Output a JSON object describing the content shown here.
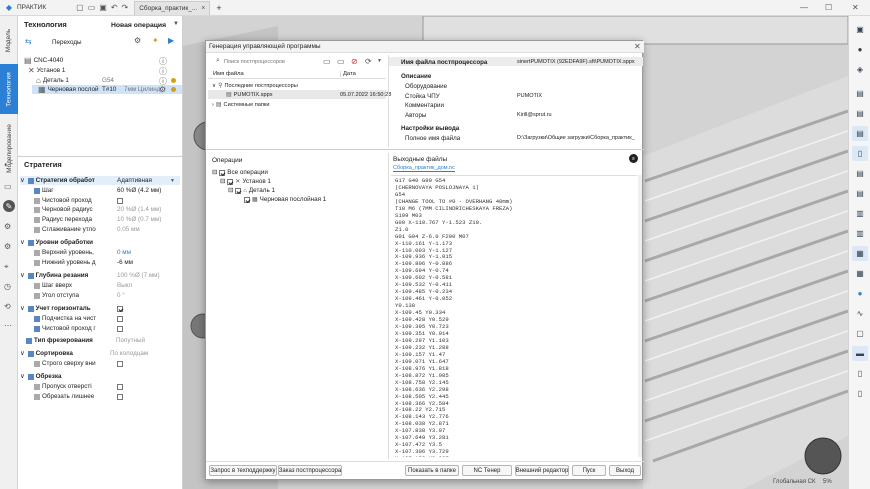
{
  "titlebar": {
    "app_name": "ПРАКТИК",
    "doc_tab": "Сборка_практик_...",
    "add_tab": "+"
  },
  "vtabs": [
    "Модель",
    "Технология",
    "Моделирование"
  ],
  "left": {
    "tech_title": "Технология",
    "new_op": "Новая операция",
    "transitions": "Переходы",
    "tree": {
      "machine": "CNC-4040",
      "setup": "Установ 1",
      "part": "Деталь 1",
      "part_g": "G54",
      "op": "Черновая послой",
      "op_tool": "T#10",
      "op_info": "7мм Цилинд"
    },
    "strategy_title": "Стратегия",
    "groups": [
      {
        "label": "Стратегия обработ",
        "value": "Адаптивная"
      },
      {
        "label": "Шаг",
        "value": "60 %Ø (4.2 мм)"
      },
      {
        "label": "Чистовой проход",
        "value": ""
      },
      {
        "label": "Черновой радиус",
        "value": "20 %Ø (1.4 мм)"
      },
      {
        "label": "Радиус перехода",
        "value": "10 %Ø (0.7 мм)"
      },
      {
        "label": "Сглаживание утло",
        "value": "0.05 мм"
      },
      {
        "label": "Уровни обработки",
        "value": ""
      },
      {
        "label": "Верхний уровень,",
        "value": "0 мм"
      },
      {
        "label": "Нижний уровень д",
        "value": "-6 мм"
      },
      {
        "label": "Глубина резания",
        "value": "100 %Ø (7 мм)"
      },
      {
        "label": "Шаг вверх",
        "value": "Выкл"
      },
      {
        "label": "Угол отступа",
        "value": "0 °"
      },
      {
        "label": "Учет горизонталь",
        "value": ""
      },
      {
        "label": "Подчистка на чист",
        "value": ""
      },
      {
        "label": "Чистовой проход г",
        "value": ""
      },
      {
        "label": "Тип фрезерования",
        "value": "Попутный"
      },
      {
        "label": "Сортировка",
        "value": "По колодцам"
      },
      {
        "label": "Строго сверху вни",
        "value": ""
      },
      {
        "label": "Обрезка",
        "value": ""
      },
      {
        "label": "Пропуск отверсті",
        "value": ""
      },
      {
        "label": "Обрезать лишнее",
        "value": ""
      }
    ]
  },
  "dialog": {
    "title": "Генерация управляющей программы",
    "search_placeholder": "Поиск постпроцессоров",
    "col_file": "Имя файла",
    "col_date": "Дата",
    "recent": "Последние постпроцессоры",
    "pp_file": "PUMOTIX.sppx",
    "pp_date": "05.07.2022 16:50:28",
    "sys_folders": "Системные папки",
    "props": {
      "pp_name_label": "Имя файла постпроцессора",
      "pp_name_value": "sinertPUMOTIX (92EDFA9F).sft\\PUMOTIX.sppx",
      "desc_label": "Описание",
      "equip_label": "Оборудование",
      "cnc_label": "Стойка ЧПУ",
      "cnc_value": "PUMOTIX",
      "comments_label": "Комментарии",
      "authors_label": "Авторы",
      "authors_value": "Kirill@sprut.ru",
      "output_label": "Настройки вывода",
      "path_label": "Полное имя файла",
      "path_value": "D:\\Загрузки\\Общие загрузки\\Сборка_практик_"
    },
    "ops_title": "Операции",
    "ops_all": "Все операции",
    "ops_setup": "Установ 1",
    "ops_part": "Деталь 1",
    "ops_op": "Черновая послойная 1",
    "out_title": "Выходные файлы",
    "out_file": "Сборка_практик_дом.nc",
    "gcode": "G17 G40 G90 G54\n(CHERNOVAYA POSLOJNAYA 1)\nG54\n(CHANGE TOOL TO #0 - OVERHANG 40mm)\nT10 M6 (7MM CILINDRICHESKAYA FREZA)\nS199 M03\nG00 X-110.767 Y-1.523 Z10.\nZ1.0\nG01 G94 Z-6.0 F200 M07\nX-110.161 Y-1.173\nX-110.003 Y-1.127\nX-109.936 Y-1.015\nX-109.806 Y-0.886\nX-109.694 Y-0.74\nX-109.602 Y-0.581\nX-109.532 Y-0.411\nX-109.485 Y-0.234\nX-109.461 Y-0.052\nY0.138\nX-109.45 Y0.334\nX-109.428 Y0.529\nX-109.395 Y0.723\nX-109.351 Y0.914\nX-109.297 Y1.103\nX-109.232 Y1.288\nX-109.157 Y1.47\nX-109.071 Y1.647\nX-108.976 Y1.818\nX-108.872 Y1.985\nX-108.758 Y2.145\nX-108.636 Y2.298\nX-108.505 Y2.445\nX-108.366 Y2.584\nX-108.22 Y2.715\nX-108.143 Y2.776\nX-108.038 Y2.871\nX-107.838 Y3.07\nX-107.649 Y3.281\nX-107.472 Y3.5\nX-107.306 Y3.729\nX-107.152 Y3.967\nX-107.011 Y4.212",
    "buttons": {
      "tech_request": "Запрос в техподдержку",
      "pp_order": "Заказ постпроцессора",
      "show_folder": "Показать в папке",
      "nc_viewer": "NC Тенер",
      "ext_editor": "Внешний редактор",
      "run": "Пуск",
      "exit": "Выход"
    }
  },
  "status": {
    "label": "Глобальная СК",
    "zoom": "5%"
  },
  "colors": {
    "accent": "#2b7fd4",
    "stripe": "#e8e8e8"
  }
}
